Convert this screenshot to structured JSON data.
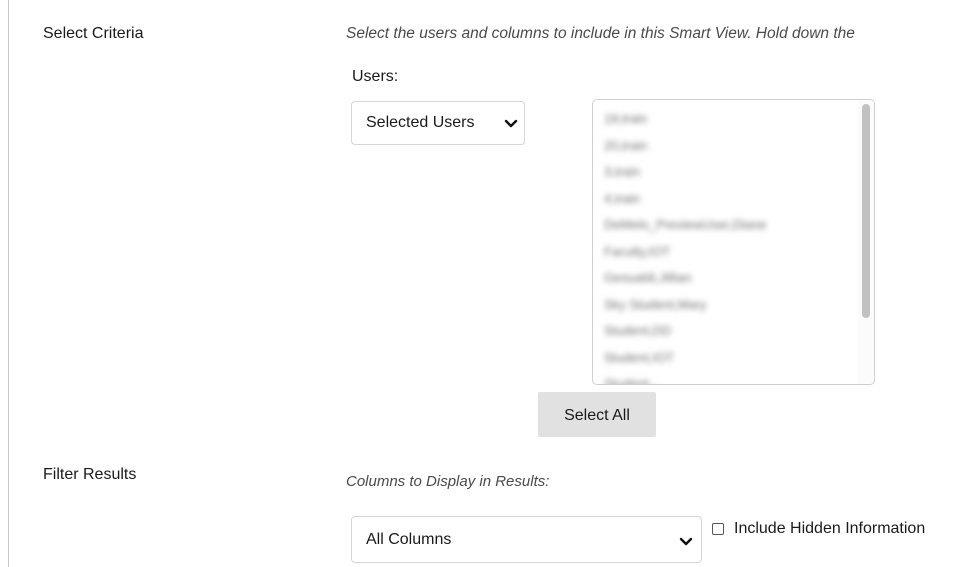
{
  "sections": {
    "select_criteria": {
      "label": "Select Criteria",
      "instructions": "Select the users and columns to include in this Smart View. Hold down the"
    },
    "users": {
      "label": "Users:",
      "dropdown_value": "Selected Users",
      "list_items": [
        "19,train",
        "20,train",
        "3,train",
        "4,train",
        "DeMelo_PreviewUser,Diane",
        "Faculty,IOT",
        "Gesualdi,Jillian",
        "Sky Student,Mary",
        "Student,DD",
        "Student,IOT",
        "Student,..."
      ],
      "select_all_label": "Select All"
    },
    "filter_results": {
      "label": "Filter Results",
      "columns_label": "Columns to Display in Results:",
      "columns_dropdown_value": "All Columns",
      "include_hidden_label": "Include Hidden Information",
      "include_hidden_checked": false
    }
  },
  "icons": {
    "dropdown": "chevron-down-icon"
  },
  "colors": {
    "button_bg": "#e1e1e1",
    "border": "#d6d6d6",
    "italic_text": "#4a4a4a"
  }
}
